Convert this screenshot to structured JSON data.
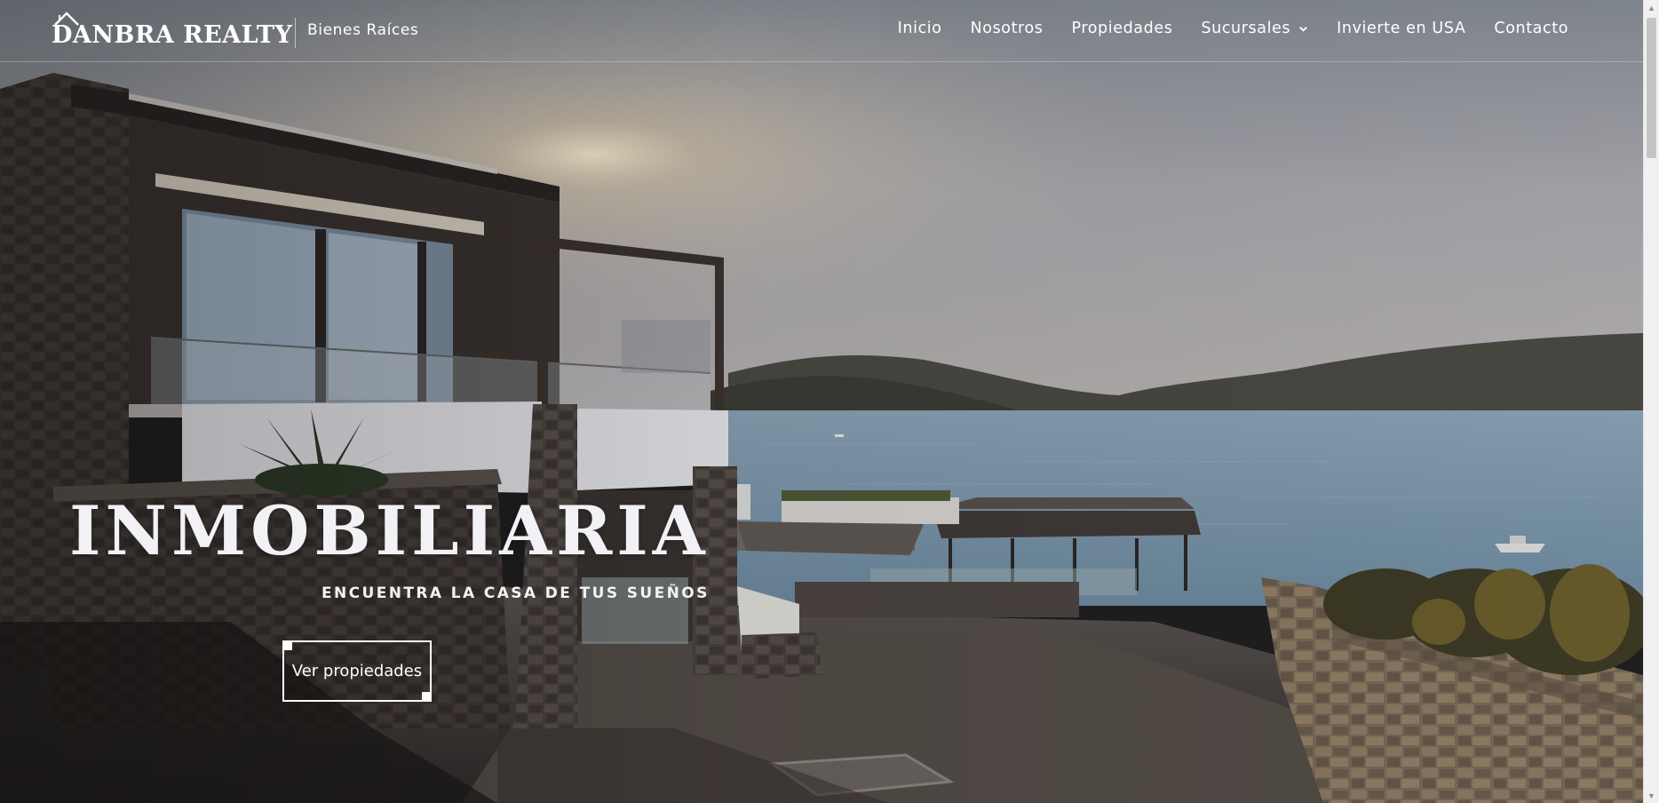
{
  "brand": {
    "name": "DANBRA REALTY",
    "tagline": "Bienes Raíces",
    "logo_icon": "house-roof-icon"
  },
  "nav": {
    "items": [
      {
        "label": "Inicio"
      },
      {
        "label": "Nosotros"
      },
      {
        "label": "Propiedades"
      },
      {
        "label": "Sucursales",
        "has_dropdown": true
      },
      {
        "label": "Invierte en USA"
      },
      {
        "label": "Contacto"
      }
    ]
  },
  "hero": {
    "title": "INMOBILIARIA",
    "subtitle": "ENCUENTRA LA CASA DE TUS SUEÑOS",
    "cta_label": "Ver propiedades"
  },
  "colors": {
    "text": "#ffffff",
    "sky_top": "#8d939b",
    "sea": "#7c97ac"
  }
}
